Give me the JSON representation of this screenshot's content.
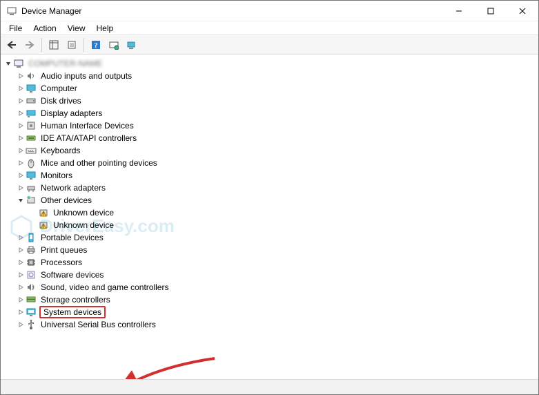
{
  "window": {
    "title": "Device Manager"
  },
  "menu": {
    "file": "File",
    "action": "Action",
    "view": "View",
    "help": "Help"
  },
  "root": {
    "name": "COMPUTER-NAME"
  },
  "categories": [
    {
      "key": "audio",
      "label": "Audio inputs and outputs",
      "icon": "speaker-icon"
    },
    {
      "key": "computer",
      "label": "Computer",
      "icon": "monitor-icon"
    },
    {
      "key": "disk",
      "label": "Disk drives",
      "icon": "disk-icon"
    },
    {
      "key": "display",
      "label": "Display adapters",
      "icon": "display-adapter-icon"
    },
    {
      "key": "hid",
      "label": "Human Interface Devices",
      "icon": "hid-icon"
    },
    {
      "key": "ide",
      "label": "IDE ATA/ATAPI controllers",
      "icon": "ide-icon"
    },
    {
      "key": "keyboards",
      "label": "Keyboards",
      "icon": "keyboard-icon"
    },
    {
      "key": "mice",
      "label": "Mice and other pointing devices",
      "icon": "mouse-icon"
    },
    {
      "key": "monitors",
      "label": "Monitors",
      "icon": "monitor-icon"
    },
    {
      "key": "network",
      "label": "Network adapters",
      "icon": "network-icon"
    },
    {
      "key": "other",
      "label": "Other devices",
      "icon": "other-icon",
      "expanded": true,
      "children": [
        {
          "key": "unknown1",
          "label": "Unknown device",
          "icon": "warning-icon"
        },
        {
          "key": "unknown2",
          "label": "Unknown device",
          "icon": "warning-icon"
        }
      ]
    },
    {
      "key": "portable",
      "label": "Portable Devices",
      "icon": "portable-icon"
    },
    {
      "key": "printq",
      "label": "Print queues",
      "icon": "printer-icon"
    },
    {
      "key": "processors",
      "label": "Processors",
      "icon": "cpu-icon"
    },
    {
      "key": "software",
      "label": "Software devices",
      "icon": "software-icon"
    },
    {
      "key": "sound",
      "label": "Sound, video and game controllers",
      "icon": "sound-controller-icon"
    },
    {
      "key": "storage",
      "label": "Storage controllers",
      "icon": "storage-icon"
    },
    {
      "key": "system",
      "label": "System devices",
      "icon": "system-icon",
      "highlighted": true
    },
    {
      "key": "usb",
      "label": "Universal Serial Bus controllers",
      "icon": "usb-icon"
    }
  ],
  "watermark": "DriverEasy.com"
}
